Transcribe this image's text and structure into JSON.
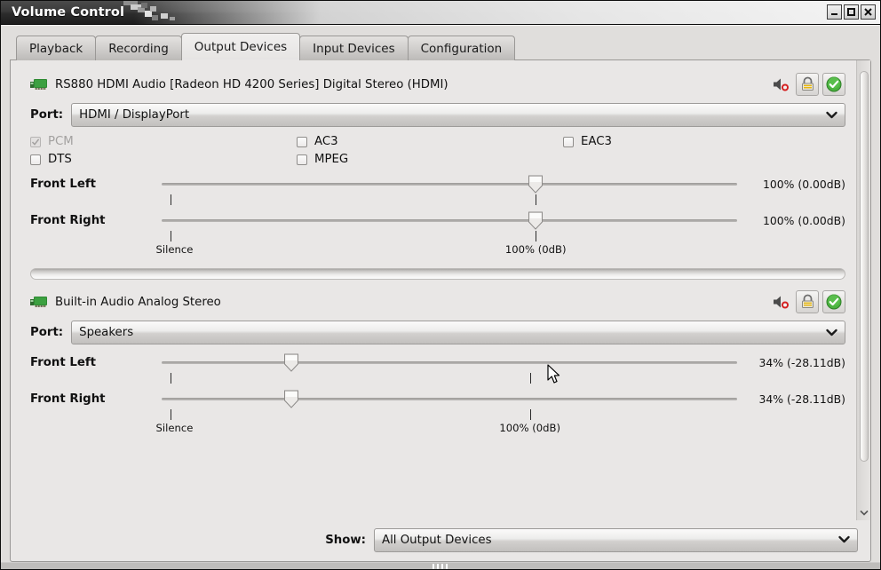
{
  "window": {
    "title": "Volume Control",
    "buttons": {
      "minimize": "minimize-button",
      "maximize": "maximize-button",
      "close": "close-button"
    }
  },
  "tabs": [
    {
      "label": "Playback",
      "active": false
    },
    {
      "label": "Recording",
      "active": false
    },
    {
      "label": "Output Devices",
      "active": true
    },
    {
      "label": "Input Devices",
      "active": false
    },
    {
      "label": "Configuration",
      "active": false
    }
  ],
  "devices": [
    {
      "name": "RS880 HDMI Audio [Radeon HD 4200 Series] Digital Stereo (HDMI)",
      "port_label": "Port:",
      "port_value": "HDMI / DisplayPort",
      "codecs": [
        {
          "label": "PCM",
          "checked": true,
          "disabled": true
        },
        {
          "label": "AC3",
          "checked": false,
          "disabled": false
        },
        {
          "label": "EAC3",
          "checked": false,
          "disabled": false
        },
        {
          "label": "DTS",
          "checked": false,
          "disabled": false
        },
        {
          "label": "MPEG",
          "checked": false,
          "disabled": false
        }
      ],
      "channels": [
        {
          "label": "Front Left",
          "value_text": "100% (0.00dB)",
          "percent": 100
        },
        {
          "label": "Front Right",
          "value_text": "100% (0.00dB)",
          "percent": 100
        }
      ],
      "scale_labels": {
        "min": "Silence",
        "base": "100% (0dB)"
      },
      "mute_icon": "speaker-muted-icon",
      "lock_icon": "lock-icon",
      "default_icon": "checkmark-default-icon"
    },
    {
      "name": "Built-in Audio Analog Stereo",
      "port_label": "Port:",
      "port_value": "Speakers",
      "codecs": [],
      "channels": [
        {
          "label": "Front Left",
          "value_text": "34% (-28.11dB)",
          "percent": 34
        },
        {
          "label": "Front Right",
          "value_text": "34% (-28.11dB)",
          "percent": 34
        }
      ],
      "scale_labels": {
        "min": "Silence",
        "base": "100% (0dB)"
      },
      "mute_icon": "speaker-muted-icon",
      "lock_icon": "lock-icon",
      "default_icon": "checkmark-default-icon"
    }
  ],
  "footer": {
    "show_label": "Show:",
    "show_value": "All Output Devices"
  },
  "colors": {
    "accent_green": "#3faa34",
    "window_bg": "#e0dedc",
    "page_bg": "#e9e7e6",
    "title_bg": "#2c2c2c",
    "text": "#111111",
    "disabled_text": "#a3a1a0"
  }
}
